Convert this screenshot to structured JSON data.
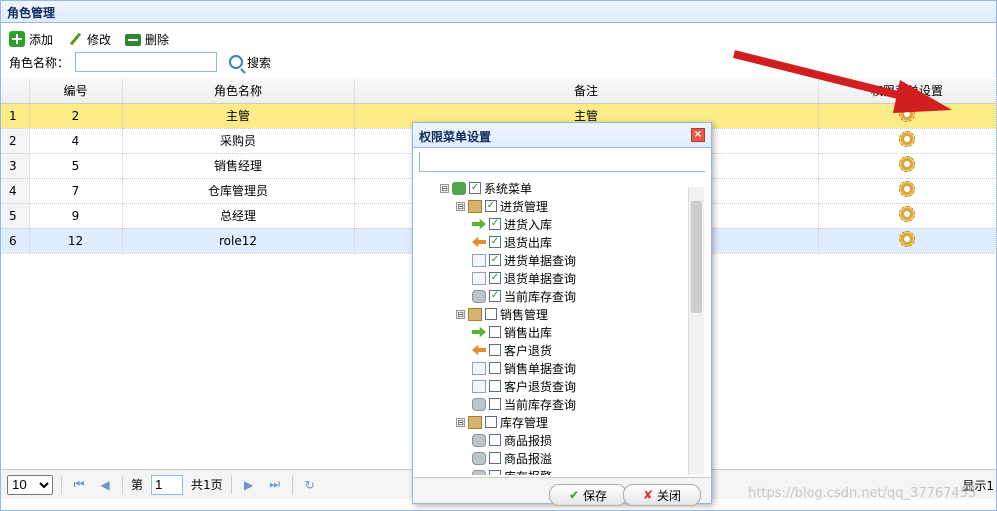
{
  "panel": {
    "title": "角色管理"
  },
  "toolbar": {
    "add": "添加",
    "edit": "修改",
    "delete": "删除"
  },
  "search": {
    "label": "角色名称：",
    "value": "",
    "button": "搜索"
  },
  "grid": {
    "columns": [
      "编号",
      "角色名称",
      "备注",
      "权限菜单设置"
    ],
    "rows": [
      {
        "rownum": "1",
        "id": "2",
        "name": "主管",
        "remark": "主管"
      },
      {
        "rownum": "2",
        "id": "4",
        "name": "采购员",
        "remark": ""
      },
      {
        "rownum": "3",
        "id": "5",
        "name": "销售经理",
        "remark": ""
      },
      {
        "rownum": "4",
        "id": "7",
        "name": "仓库管理员",
        "remark": ""
      },
      {
        "rownum": "5",
        "id": "9",
        "name": "总经理",
        "remark": ""
      },
      {
        "rownum": "6",
        "id": "12",
        "name": "role12",
        "remark": ""
      }
    ]
  },
  "pager": {
    "page_size": "10",
    "page_prefix": "第",
    "page": "1",
    "page_suffix": "共1页",
    "info": "显示1"
  },
  "dialog": {
    "title": "权限菜单设置",
    "tree": [
      {
        "label": "系统菜单",
        "level": 0,
        "checked": true,
        "icon": "root-icon",
        "expander": "⊟"
      },
      {
        "label": "进货管理",
        "level": 1,
        "checked": true,
        "icon": "folder-icon",
        "expander": "⊟"
      },
      {
        "label": "进货入库",
        "level": 2,
        "checked": true,
        "icon": "arrow-in-icon"
      },
      {
        "label": "退货出库",
        "level": 2,
        "checked": true,
        "icon": "arrow-out-icon"
      },
      {
        "label": "进货单据查询",
        "level": 2,
        "checked": true,
        "icon": "document-icon"
      },
      {
        "label": "退货单据查询",
        "level": 2,
        "checked": true,
        "icon": "document-icon"
      },
      {
        "label": "当前库存查询",
        "level": 2,
        "checked": true,
        "icon": "database-icon"
      },
      {
        "label": "销售管理",
        "level": 1,
        "checked": false,
        "icon": "folder-icon",
        "expander": "⊟"
      },
      {
        "label": "销售出库",
        "level": 2,
        "checked": false,
        "icon": "arrow-in-icon"
      },
      {
        "label": "客户退货",
        "level": 2,
        "checked": false,
        "icon": "arrow-out-icon"
      },
      {
        "label": "销售单据查询",
        "level": 2,
        "checked": false,
        "icon": "document-icon"
      },
      {
        "label": "客户退货查询",
        "level": 2,
        "checked": false,
        "icon": "document-icon"
      },
      {
        "label": "当前库存查询",
        "level": 2,
        "checked": false,
        "icon": "database-icon"
      },
      {
        "label": "库存管理",
        "level": 1,
        "checked": false,
        "icon": "folder-icon",
        "expander": "⊟"
      },
      {
        "label": "商品报损",
        "level": 2,
        "checked": false,
        "icon": "database-icon"
      },
      {
        "label": "商品报溢",
        "level": 2,
        "checked": false,
        "icon": "database-icon"
      },
      {
        "label": "库存报警",
        "level": 2,
        "checked": false,
        "icon": "database-icon"
      }
    ],
    "save": "保存",
    "close": "关闭"
  },
  "watermark": "https://blog.csdn.net/qq_37767455",
  "colors": {
    "selected_row": "#fbec88",
    "header_border": "#95b8e7",
    "arrow": "#d11f1f"
  }
}
